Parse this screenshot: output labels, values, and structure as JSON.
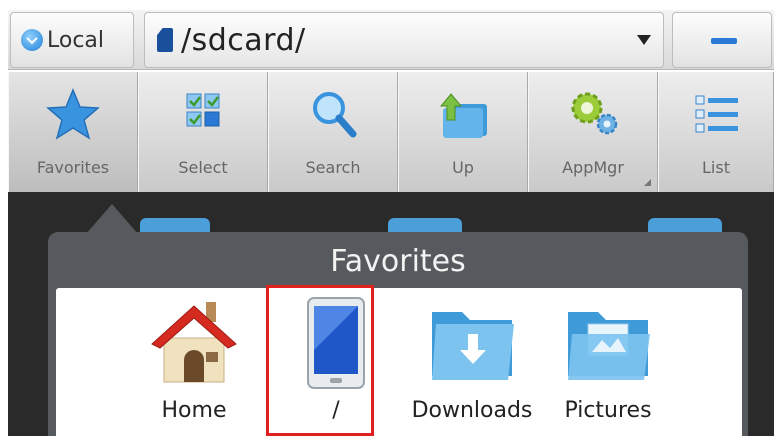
{
  "address_bar": {
    "location_label": "Local",
    "path": "/sdcard/"
  },
  "toolbar": {
    "items": [
      {
        "label": "Favorites",
        "icon": "star-icon"
      },
      {
        "label": "Select",
        "icon": "select-grid-icon"
      },
      {
        "label": "Search",
        "icon": "magnifier-icon"
      },
      {
        "label": "Up",
        "icon": "folder-up-icon"
      },
      {
        "label": "AppMgr",
        "icon": "gears-icon"
      },
      {
        "label": "List",
        "icon": "list-icon"
      }
    ]
  },
  "favorites_popup": {
    "title": "Favorites",
    "items": [
      {
        "label": "Home",
        "icon": "house-icon"
      },
      {
        "label": "/",
        "icon": "phone-icon",
        "selected": true
      },
      {
        "label": "Downloads",
        "icon": "download-folder-icon"
      },
      {
        "label": "Pictures",
        "icon": "pictures-folder-icon"
      }
    ]
  },
  "colors": {
    "accent_blue": "#2a79d4",
    "selection_red": "#e0201e",
    "popup_bg": "#565a5e"
  }
}
